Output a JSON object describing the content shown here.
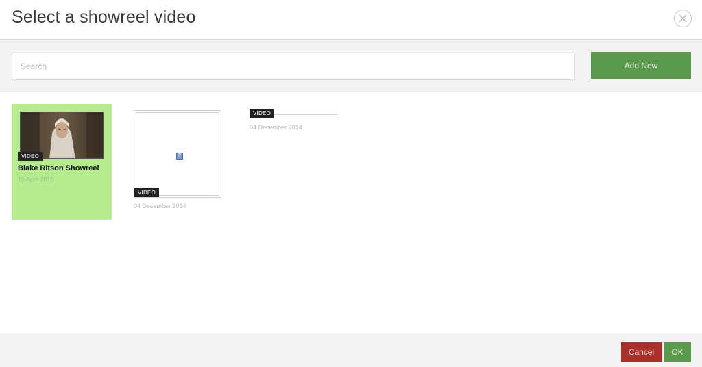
{
  "dialog": {
    "title": "Select a showreel video",
    "close_icon": "close-icon"
  },
  "toolbar": {
    "search_placeholder": "Search",
    "search_value": "",
    "add_new_label": "Add New",
    "add_new_color": "#5a9a4a"
  },
  "videos": [
    {
      "badge": "VIDEO",
      "title": "Blake Ritson Showreel",
      "date": "15 April 2015",
      "selected": true,
      "selected_color": "#b4ec8f"
    },
    {
      "badge": "VIDEO",
      "title": "",
      "date": "04 December 2014",
      "selected": false
    },
    {
      "badge": "VIDEO",
      "title": "",
      "date": "04 December 2014",
      "selected": false
    }
  ],
  "footer": {
    "cancel_label": "Cancel",
    "cancel_color": "#a9302b",
    "ok_label": "OK",
    "ok_color": "#5a9a4a"
  }
}
